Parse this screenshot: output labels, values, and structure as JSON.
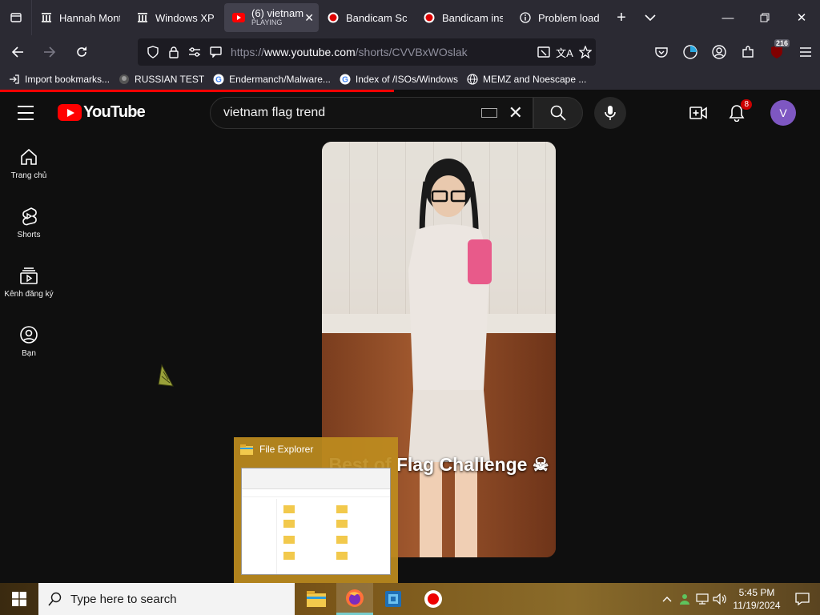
{
  "browser": {
    "tabs": [
      {
        "label": "Hannah Mont",
        "icon": "archive-icon"
      },
      {
        "label": "Windows XP H",
        "icon": "archive-icon"
      },
      {
        "label": "(6) vietnam",
        "sub": "PLAYING",
        "icon": "youtube-icon",
        "active": true
      },
      {
        "label": "Bandicam Scr",
        "icon": "bandicam-icon"
      },
      {
        "label": "Bandicam inst",
        "icon": "bandicam-icon"
      },
      {
        "label": "Problem load",
        "icon": "info-icon"
      }
    ],
    "url_prefix": "https://",
    "url_host": "www.youtube.com",
    "url_path": "/shorts/CVVBxWOslak",
    "extension_badge": "216",
    "bookmarks": [
      {
        "label": "Import bookmarks...",
        "icon": "import-icon"
      },
      {
        "label": "RUSSIAN TEST",
        "icon": "site-icon"
      },
      {
        "label": "Endermanch/Malware...",
        "icon": "google-icon"
      },
      {
        "label": "Index of /ISOs/Windows",
        "icon": "google-icon"
      },
      {
        "label": "MEMZ and Noescape ...",
        "icon": "globe-icon"
      }
    ],
    "page_load_progress": 0.48
  },
  "youtube": {
    "logo_text": "YouTube",
    "search_query": "vietnam flag trend",
    "notification_count": "8",
    "avatar_letter": "V",
    "guide": [
      {
        "label": "Trang chủ",
        "icon": "home-icon"
      },
      {
        "label": "Shorts",
        "icon": "shorts-icon"
      },
      {
        "label": "Kênh đăng ký",
        "icon": "subscriptions-icon"
      },
      {
        "label": "Bạn",
        "icon": "you-icon"
      }
    ],
    "short_caption": "Best of Flag Challenge ☠"
  },
  "preview": {
    "title": "File Explorer"
  },
  "taskbar": {
    "search_placeholder": "Type here to search",
    "time": "5:45 PM",
    "date": "11/19/2024",
    "pinned": [
      "file-explorer-icon",
      "firefox-icon",
      "virtualbox-icon",
      "bandicam-icon"
    ]
  },
  "colors": {
    "youtube_red": "#ff0000",
    "chrome_bg": "#2b2a33",
    "page_bg": "#0f0f0f",
    "avatar": "#7e57c2"
  }
}
